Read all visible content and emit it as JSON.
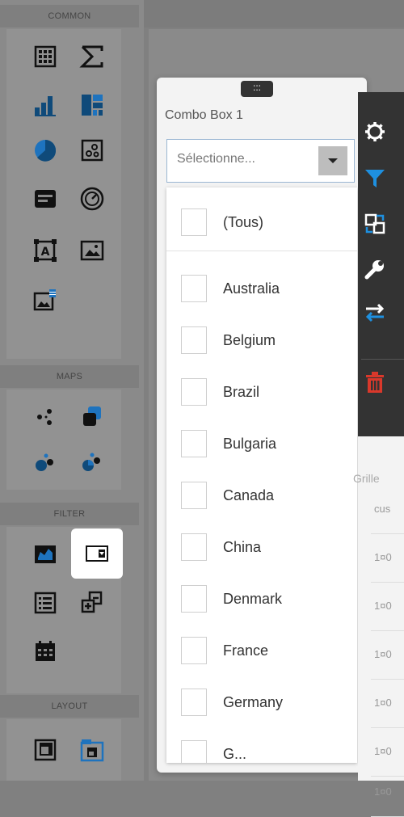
{
  "toolbox": {
    "sections": {
      "common": "COMMON",
      "maps": "MAPS",
      "filter": "FILTER",
      "layout": "LAYOUT"
    },
    "items": {
      "common": [
        "grid-icon",
        "sigma-icon",
        "bar-chart-icon",
        "treemap-icon",
        "pie-chart-icon",
        "scatter-chart-icon",
        "card-icon",
        "gauge-icon",
        "text-box-icon",
        "image-icon",
        "bound-image-icon"
      ],
      "maps": [
        "geo-point-map-icon",
        "choropleth-map-icon",
        "bubble-map-icon",
        "pie-map-icon"
      ],
      "filter": [
        "range-filter-icon",
        "combo-box-icon",
        "list-box-icon",
        "tree-view-icon",
        "date-filter-icon"
      ],
      "layout": [
        "group-icon",
        "tab-container-icon"
      ]
    },
    "selected": "combo-box-icon"
  },
  "card": {
    "handle": ":::",
    "title": "Combo Box 1",
    "combo_placeholder": "Sélectionne..."
  },
  "dropdown": {
    "all_option": "(Tous)",
    "options": [
      "Australia",
      "Belgium",
      "Brazil",
      "Bulgaria",
      "Canada",
      "China",
      "Denmark",
      "France",
      "Germany",
      "G..."
    ]
  },
  "actions": [
    "gear-icon",
    "filter-icon",
    "convert-icon",
    "wrench-icon",
    "swap-icon",
    "trash-icon"
  ],
  "grid": {
    "title": "Grille",
    "header": "cus",
    "cells": [
      "1¤0",
      "1¤0",
      "1¤0",
      "1¤0",
      "1¤0",
      "1¤0"
    ]
  },
  "colors": {
    "accent_blue": "#1e73be",
    "dark_blue": "#0f4a7a",
    "delete_red": "#d9382b"
  }
}
